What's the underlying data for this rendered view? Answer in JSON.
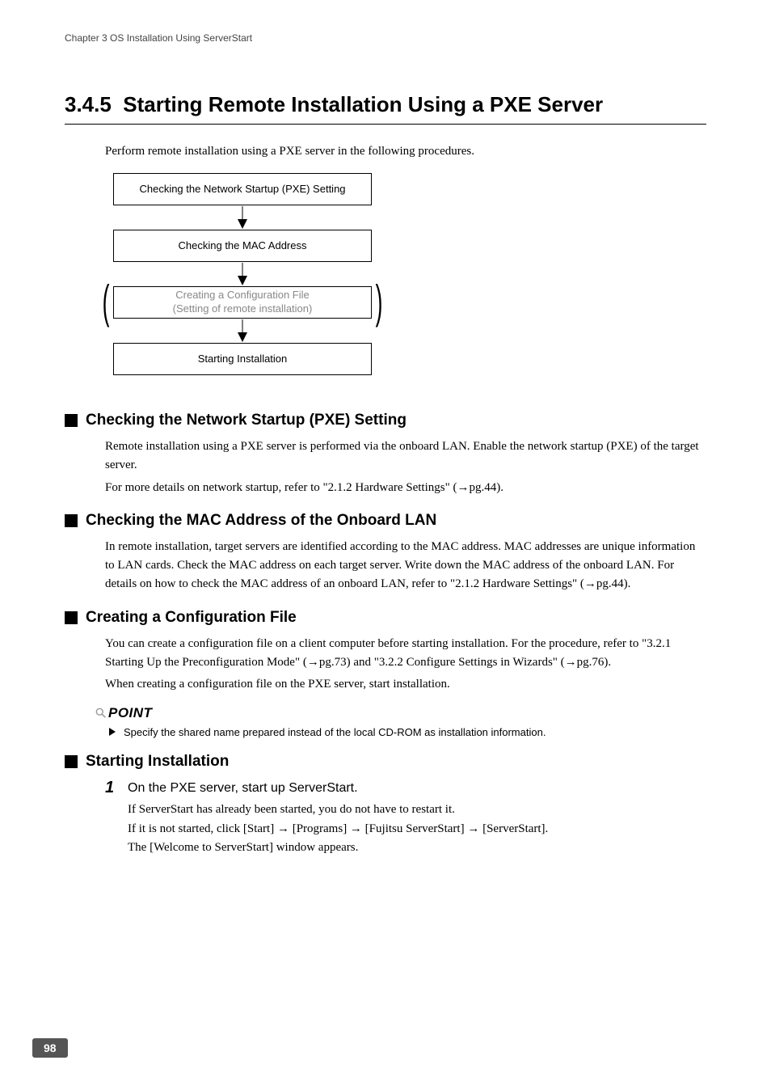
{
  "header": "Chapter 3  OS Installation Using ServerStart",
  "section_number": "3.4.5",
  "section_title": "Starting Remote Installation Using a PXE Server",
  "intro": "Perform remote installation using a PXE server in the following procedures.",
  "flow": {
    "box1": "Checking the Network Startup (PXE) Setting",
    "box2": "Checking the MAC Address",
    "box3_line1": "Creating a Configuration File",
    "box3_line2": "(Setting of remote installation)",
    "box4": "Starting Installation"
  },
  "sub1": {
    "title": "Checking the Network Startup (PXE) Setting",
    "p1": "Remote installation using a PXE server is performed via the onboard LAN. Enable the network startup (PXE) of the target server.",
    "p2": "For more details on network startup, refer to \"2.1.2 Hardware Settings\" (→pg.44)."
  },
  "sub2": {
    "title": "Checking the MAC Address of the Onboard LAN",
    "p1": "In remote installation, target servers are identified according to the MAC address. MAC addresses are unique information to LAN cards. Check the MAC address on each target server. Write down the MAC address of the onboard LAN. For details on how to check the MAC address of an onboard LAN, refer to \"2.1.2 Hardware Settings\" (→pg.44)."
  },
  "sub3": {
    "title": "Creating a Configuration File",
    "p1": "You can create a configuration file on a client computer before starting installation. For the procedure, refer to \"3.2.1 Starting Up the Preconfiguration Mode\" (→pg.73) and \"3.2.2 Configure Settings in Wizards\" (→pg.76).",
    "p2": " When creating a configuration file on the PXE server, start installation."
  },
  "point": {
    "label": "POINT",
    "item1": "Specify the shared name prepared instead of the local CD-ROM as installation information."
  },
  "sub4": {
    "title": "Starting Installation",
    "step1_num": "1",
    "step1_title": "On the PXE server, start up ServerStart.",
    "step1_l1": "If ServerStart has already been started, you do not have to restart it.",
    "step1_l2": "If it is not started, click [Start] → [Programs] → [Fujitsu ServerStart] → [ServerStart].",
    "step1_l3": "The [Welcome to ServerStart] window appears."
  },
  "page_number": "98"
}
